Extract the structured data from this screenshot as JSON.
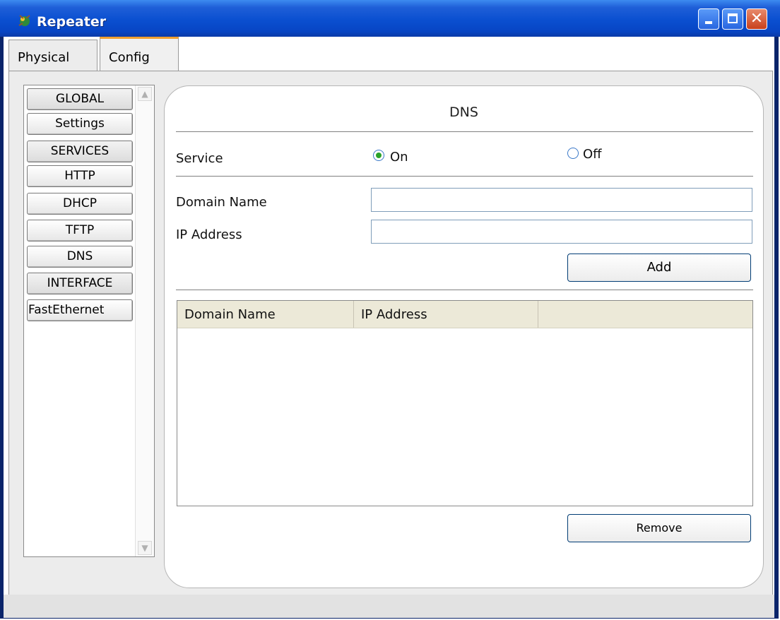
{
  "window": {
    "title": "Repeater",
    "close_glyph": "✕"
  },
  "tabs": [
    {
      "label": "Physical"
    },
    {
      "label": "Config"
    }
  ],
  "sidebar": {
    "items": [
      {
        "label": "GLOBAL"
      },
      {
        "label": "Settings"
      },
      {
        "label": "SERVICES"
      },
      {
        "label": "HTTP"
      },
      {
        "label": "DHCP"
      },
      {
        "label": "TFTP"
      },
      {
        "label": "DNS"
      },
      {
        "label": "INTERFACE"
      },
      {
        "label": "FastEthernet"
      }
    ],
    "scroll_up": "▲",
    "scroll_down": "▼"
  },
  "dns": {
    "title": "DNS",
    "service_label": "Service",
    "service_on_label": "On",
    "service_off_label": "Off",
    "service_selected": "On",
    "domain_name_label": "Domain Name",
    "domain_name_value": "",
    "ip_address_label": "IP Address",
    "ip_address_value": "",
    "add_button": "Add",
    "remove_button": "Remove",
    "table": {
      "columns": [
        "Domain Name",
        "IP Address",
        ""
      ],
      "rows": []
    }
  },
  "colors": {
    "titlebar": "#0a4fd0",
    "radio_selected": "#2aa22a",
    "tab_accent": "#f0a030"
  },
  "icons": {
    "app": "repeater-app-icon",
    "minimize": "minimize-icon",
    "maximize": "maximize-icon",
    "close": "close-icon"
  }
}
